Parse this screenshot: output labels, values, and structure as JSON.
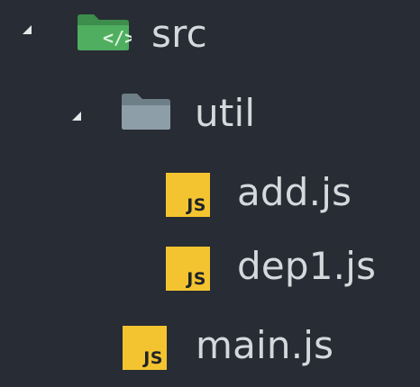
{
  "tree": {
    "src": {
      "label": "src",
      "icon": "folder-code-icon",
      "expanded": true
    },
    "util": {
      "label": "util",
      "icon": "folder-icon",
      "expanded": true
    },
    "files": [
      {
        "label": "add.js",
        "icon_text": "JS"
      },
      {
        "label": "dep1.js",
        "icon_text": "JS"
      },
      {
        "label": "main.js",
        "icon_text": "JS"
      }
    ]
  },
  "colors": {
    "background": "#282c34",
    "text": "#d5d8dc",
    "src_folder": "#4aa35a",
    "util_folder": "#8a9aa3",
    "js_badge": "#f4c430"
  }
}
